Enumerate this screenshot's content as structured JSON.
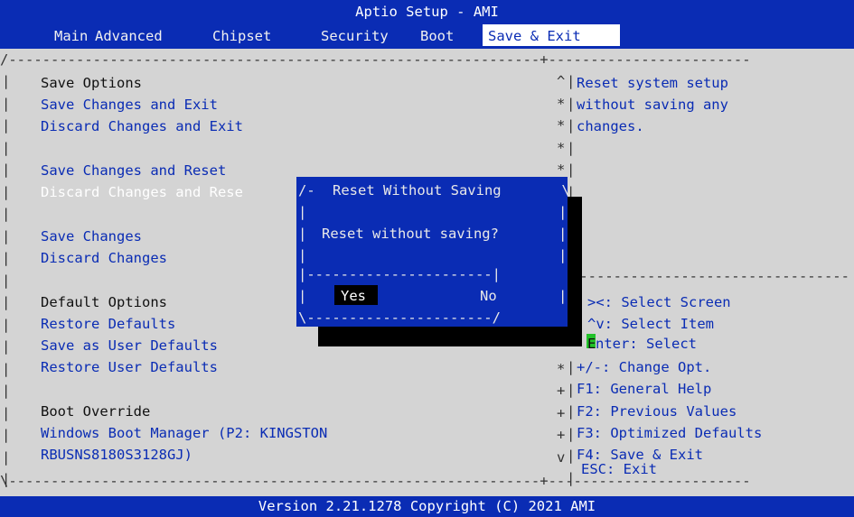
{
  "title": "Aptio Setup - AMI",
  "menu": {
    "items": [
      "Main",
      "Advanced",
      "Chipset",
      "Security",
      "Boot",
      "Save & Exit"
    ],
    "active": "Save & Exit"
  },
  "left": {
    "save_options": "Save Options",
    "save_changes_exit": "Save Changes and Exit",
    "discard_changes_exit": "Discard Changes and Exit",
    "save_changes_reset": "Save Changes and Reset",
    "discard_changes_reset": "Discard Changes and Rese",
    "save_changes": "Save Changes",
    "discard_changes": "Discard Changes",
    "default_options": "Default Options",
    "restore_defaults": "Restore Defaults",
    "save_user_defaults": "Save as User Defaults",
    "restore_user_defaults": "Restore User Defaults",
    "boot_override": "Boot Override",
    "boot_option_line1": "Windows Boot Manager (P2: KINGSTON",
    "boot_option_line2": "RBUSNS8180S3128GJ)"
  },
  "help": {
    "line1": "Reset system setup",
    "line2": "without saving any",
    "line3": "changes."
  },
  "keys": {
    "select_screen": "><: Select Screen",
    "select_item": "^v: Select Item",
    "enter_prefix": "E",
    "enter_rest": "nter: Select",
    "change_opt": "+/-: Change Opt.",
    "f1": "F1: General Help",
    "f2": "F2: Previous Values",
    "f3": "F3: Optimized Defaults",
    "f4": "F4: Save & Exit",
    "esc": "ESC: Exit"
  },
  "dialog": {
    "title": "Reset Without Saving",
    "message": "Reset without saving?",
    "yes": "Yes",
    "no": "No"
  },
  "footer": {
    "version": "Version 2.21.1278 Copyright (C) 2021 AMI"
  },
  "colors": {
    "bios_blue": "#0a2cb4",
    "background": "#d4d4d4",
    "green_cursor": "#22c22a"
  }
}
